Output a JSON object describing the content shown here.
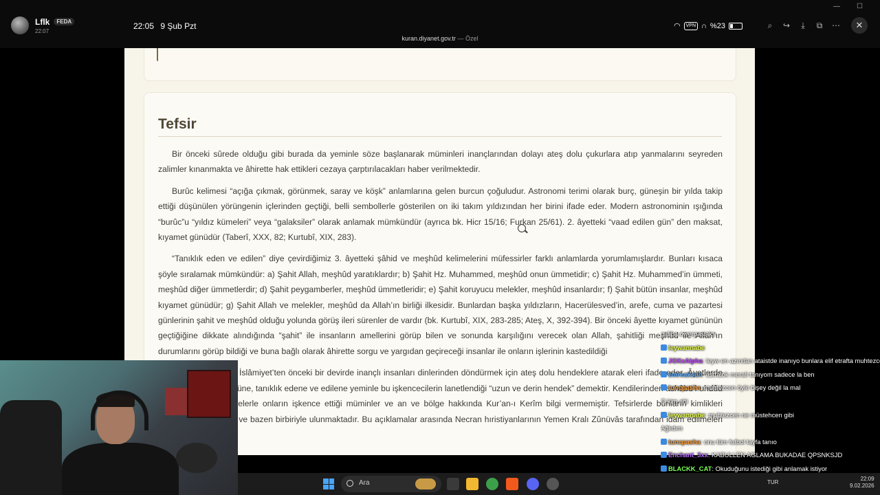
{
  "window": {
    "user_name": "Lflk",
    "user_badge": "FEDA",
    "user_time": "22:07",
    "status_time": "22:05",
    "status_date": "9 Şub Pzt",
    "vpn": "VPN",
    "battery": "%23",
    "url": "kuran.diyanet.gov.tr",
    "url_mode": "— Özel",
    "icons": [
      "zoom-in-icon",
      "share-icon",
      "download-icon",
      "external-icon",
      "more-icon"
    ],
    "close": "✕"
  },
  "page": {
    "title": "Tefsir",
    "paragraphs": [
      "Bir önceki sûrede olduğu gibi burada da yeminle söze başlanarak müminleri inançlarından dolayı ateş dolu çukurlara atıp yanmalarını seyreden zalimler kınanmakta ve âhirette hak ettikleri cezaya çarptırılacakları haber verilmektedir.",
      "Burûc kelimesi “açığa çıkmak, görünmek, saray ve köşk” anlamlarına gelen burcun çoğuludur. Astronomi terimi olarak burç, güneşin bir yılda takip ettiği düşünülen yörüngenin içlerinden geçtiği, belli sembollerle gösterilen on iki takım yıldızından her birini ifade eder. Modern astronominin ışığında “burûc”u “yıldız kümeleri” veya “galaksiler” olarak anlamak mümkündür (ayrıca bk. Hicr 15/16; Furkan 25/61). 2. âyetteki “vaad edilen gün” den maksat, kıyamet günüdür (Taberî, XXX, 82; Kurtubî, XIX, 283).",
      "“Tanıklık eden ve edilen” diye çevirdiğimiz 3. âyetteki şâhid ve meşhûd kelimelerini müfessirler farklı anlamlarda yorumlamışlardır. Bunları kısaca şöyle sıralamak mümkündür: a) Şahit Allah, meşhûd yaratıklardır; b) Şahit Hz. Muhammed, meşhûd onun ümmetidir; c) Şahit Hz. Muhammed’in ümmeti, meşhûd diğer ümmetlerdir; d) Şahit peygamberler, meşhûd ümmetleridir; e) Şahit koruyucu melekler, meşhûd insanlardır; f) Şahit bütün insanlar, meşhûd kıyamet günüdür; g) Şahit Allah ve melekler, meşhûd da Allah’ın birliği ilkesidir. Bunlardan başka yıldızların, Hacerülesved’in, arefe, cuma ve pazartesi günlerinin şahit ve meşhûd olduğu yolunda görüş ileri sürenler de vardır (bk. Kurtubî, XIX, 283-285; Ateş, X, 392-394). Bir önceki âyette kıyamet gününün geçtiğiğine dikkate alındığında “şahit” ile insanların amellerini görüp bilen ve sonunda karşılığını verecek olan Allah, şahitliği meşhûd ile Allah’ın durumlarını görüp bildiği ve buna bağlı olarak âhirette sorgu ve yargıdan geçireceği insanlar ile onların işlerinin kastedildiği",
      "“ashâbü’l-uhdûd”, İslâmiyet’ten önceki bir devirde inançlı insanları dinlerinden döndürmek için ateş dolu hendeklere atarak eleri ifade eder. Âyetlerde semaya, kıyamet gününe, tanıklık edene ve edilene yeminle bu işkencecilerin lanetlendiği “uzun ve derin hendek” demektir. Kendilerinden ashâbü’l-uhdûd diye söz edilen kimselerle onların işkence ettiği müminler ve an ve bölge hakkında Kur’an-ı Kerîm bilgi vermemiştir. Tefsirlerde bunların kimlikleri hakkında çok değişik ve bazen birbiriyle ulunmaktadır. Bu açıklamalar arasında Necran hıristiyanlarının Yemen Kralı Zûnüvâs tarafından idam edilmeleri yer alır."
    ]
  },
  "chat": [
    {
      "user": "",
      "msg": "galiba owerpasiaks",
      "color": "#ffffff"
    },
    {
      "user": "leywannabe",
      "msg": "",
      "color": "#e8ff4a"
    },
    {
      "user": "JOXxAlpha",
      "msg": ": leyw en azından ataistde inanıyo bunlara elif etrafta muhtezcenim diyip burçlara inanıyo aq bu kadar kendinle celişemess in ye",
      "color": "#c24bff"
    },
    {
      "user": "emreaksun",
      "msg": ": astralok merali tanıyom sadece la ben",
      "color": "#5fb0ff"
    },
    {
      "user": "tuncpasha",
      "msg": ": muhtezcen öyle bişey değil la mal",
      "color": "#ff9d2e"
    },
    {
      "user": "",
      "msg": "O kim abi",
      "color": "#ffffff"
    },
    {
      "user": "leywannabe",
      "msg": ": muhtezcen ne müstehcen gibi",
      "color": "#e8ff4a"
    },
    {
      "user": "",
      "msg": "Ağlıdım",
      "color": "#ffffff"
    },
    {
      "user": "tuncpasha",
      "msg": ": onu tüm futbol tayfa tanıo",
      "color": "#ff9d2e"
    },
    {
      "user": "Enchant_3xx",
      "msg": ": KABULLEN AGLAMA BUKADAE QPSNKSJD",
      "color": "#b56cff"
    },
    {
      "user": "BLACKK_CAT",
      "msg": ": Okuduğunu istediği gibi anlamak istiyor",
      "color": "#7dff5a"
    }
  ],
  "taskbar": {
    "search_placeholder": "Ara",
    "lang": "TUR",
    "time": "22:09",
    "date": "9.02.2026"
  }
}
